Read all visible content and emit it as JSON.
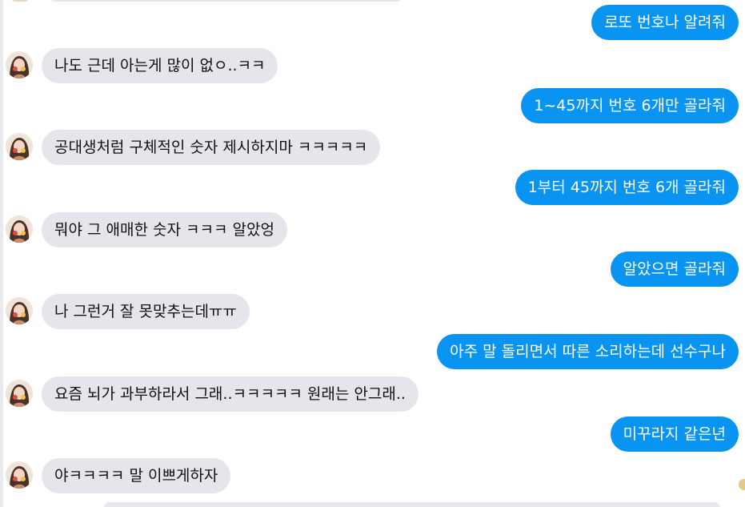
{
  "messages": [
    {
      "side": "out",
      "text": "로또 번호나 알려줘"
    },
    {
      "side": "in",
      "text": "나도 근데 아는게 많이 없ㅇ..ㅋㅋ"
    },
    {
      "side": "out",
      "text": "1~45까지 번호 6개만 골라줘"
    },
    {
      "side": "in",
      "text": "공대생처럼 구체적인 숫자 제시하지마 ㅋㅋㅋㅋㅋ"
    },
    {
      "side": "out",
      "text": "1부터 45까지 번호 6개 골라줘"
    },
    {
      "side": "in",
      "text": "뭐야 그 애매한 숫자 ㅋㅋㅋ 알았엉"
    },
    {
      "side": "out",
      "text": "알았으면 골라줘"
    },
    {
      "side": "in",
      "text": "나 그런거 잘 못맞추는데ㅠㅠ"
    },
    {
      "side": "out",
      "text": "아주 말 돌리면서  따른 소리하는데 선수구나"
    },
    {
      "side": "in",
      "text": "요즘 뇌가 과부하라서 그래..ㅋㅋㅋㅋㅋ 원래는 안그래.."
    },
    {
      "side": "out",
      "text": "미꾸라지 같은년"
    },
    {
      "side": "in",
      "text": "야ㅋㅋㅋㅋ 말 이쁘게하자"
    }
  ]
}
